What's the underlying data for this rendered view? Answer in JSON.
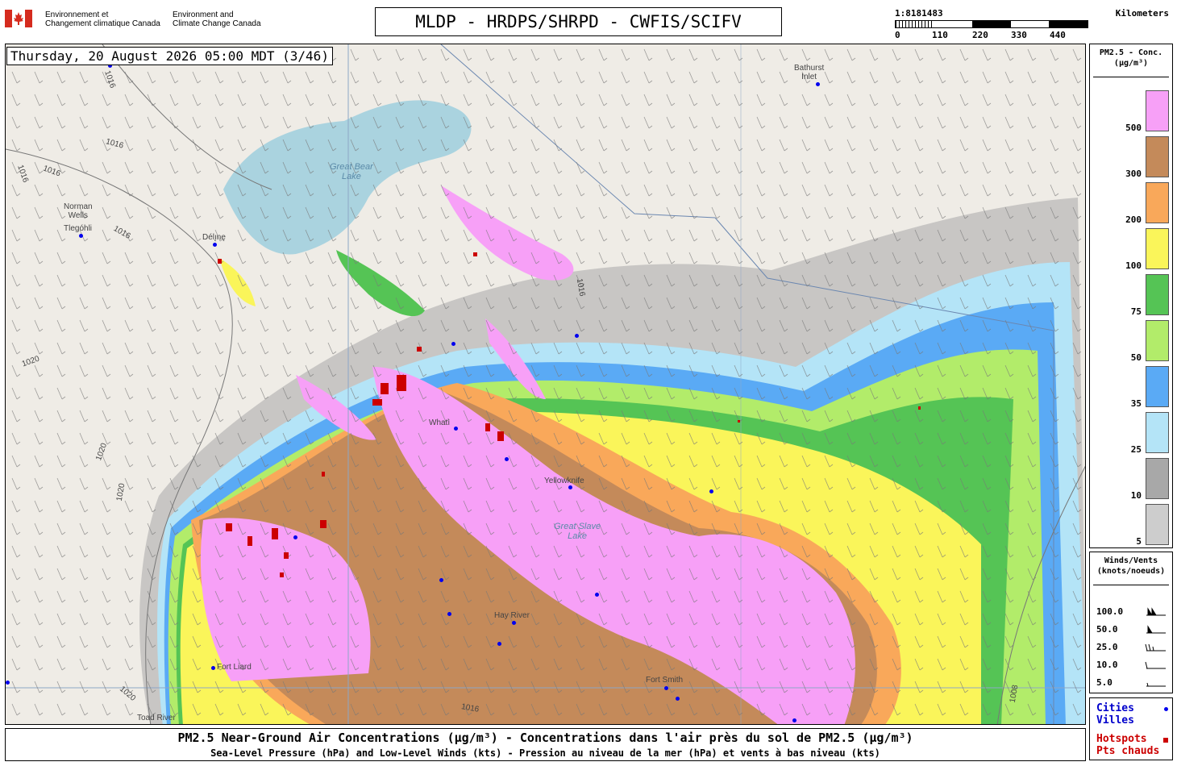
{
  "header": {
    "org_fr_line1": "Environnement et",
    "org_fr_line2": "Changement climatique Canada",
    "org_en_line1": "Environment and",
    "org_en_line2": "Climate Change Canada",
    "title": "MLDP - HRDPS/SHRPD - CWFIS/SCIFV"
  },
  "scale": {
    "ratio": "1:8181483",
    "unit": "Kilometers",
    "ticks": [
      "0",
      "110",
      "220",
      "330",
      "440"
    ]
  },
  "map": {
    "timestamp": "Thursday, 20 August 2026 05:00 MDT (3/46)",
    "places": [
      {
        "name": "Bathurst Inlet",
        "line1": "Bathurst",
        "line2": "Inlet"
      },
      {
        "name": "Norman Wells",
        "line1": "Norman",
        "line2": "Wells"
      },
      {
        "name": "Tlegohli",
        "line1": "Tlegóhli",
        "line2": ""
      },
      {
        "name": "Deline",
        "line1": "Délı̨nę",
        "line2": ""
      },
      {
        "name": "Whati",
        "line1": "Whatì",
        "line2": ""
      },
      {
        "name": "Yellowknife",
        "line1": "Yellowknife",
        "line2": ""
      },
      {
        "name": "Hay River",
        "line1": "Hay River",
        "line2": ""
      },
      {
        "name": "Fort Smith",
        "line1": "Fort Smith",
        "line2": ""
      },
      {
        "name": "Fort Liard",
        "line1": "Fort Liard",
        "line2": ""
      },
      {
        "name": "Toad River",
        "line1": "Toad River",
        "line2": ""
      }
    ],
    "water_labels": [
      {
        "line1": "Great Bear",
        "line2": "Lake"
      },
      {
        "line1": "Great Slave",
        "line2": "Lake"
      }
    ],
    "isobars": [
      "1016",
      "1016",
      "1016",
      "1016",
      "1016",
      "1020",
      "1020",
      "1020",
      "1020",
      "1016",
      "1016",
      "1008"
    ]
  },
  "legend_conc": {
    "title_line1": "PM2.5 - Conc.",
    "title_line2": "(µg/m³)",
    "levels": [
      {
        "label": "500",
        "color": "#f7a0f7"
      },
      {
        "label": "300",
        "color": "#c48a5a"
      },
      {
        "label": "200",
        "color": "#f9a85a"
      },
      {
        "label": "100",
        "color": "#faf55a"
      },
      {
        "label": "75",
        "color": "#55c455"
      },
      {
        "label": "50",
        "color": "#b2ec6a"
      },
      {
        "label": "35",
        "color": "#5aaaf5"
      },
      {
        "label": "25",
        "color": "#b4e4f7"
      },
      {
        "label": "10",
        "color": "#a8a8a8"
      },
      {
        "label": "5",
        "color": "#cdcdcd"
      }
    ]
  },
  "legend_wind": {
    "title_line1": "Winds/Vents",
    "title_line2": "(knots/noeuds)",
    "levels": [
      "100.0",
      "50.0",
      "25.0",
      "10.0",
      "5.0"
    ]
  },
  "legend_points": {
    "cities_en": "Cities",
    "cities_fr": "Villes",
    "hotspots_en": "Hotspots",
    "hotspots_fr": "Pts chauds",
    "city_color": "#0000ee",
    "hotspot_color": "#cc0000"
  },
  "footer": {
    "line1": "PM2.5 Near-Ground Air Concentrations (µg/m³) - Concentrations dans l'air près du sol de PM2.5 (µg/m³)",
    "line2": "Sea-Level Pressure (hPa) and Low-Level Winds (kts) - Pression au niveau de la mer (hPa) et vents à bas niveau (kts)"
  }
}
